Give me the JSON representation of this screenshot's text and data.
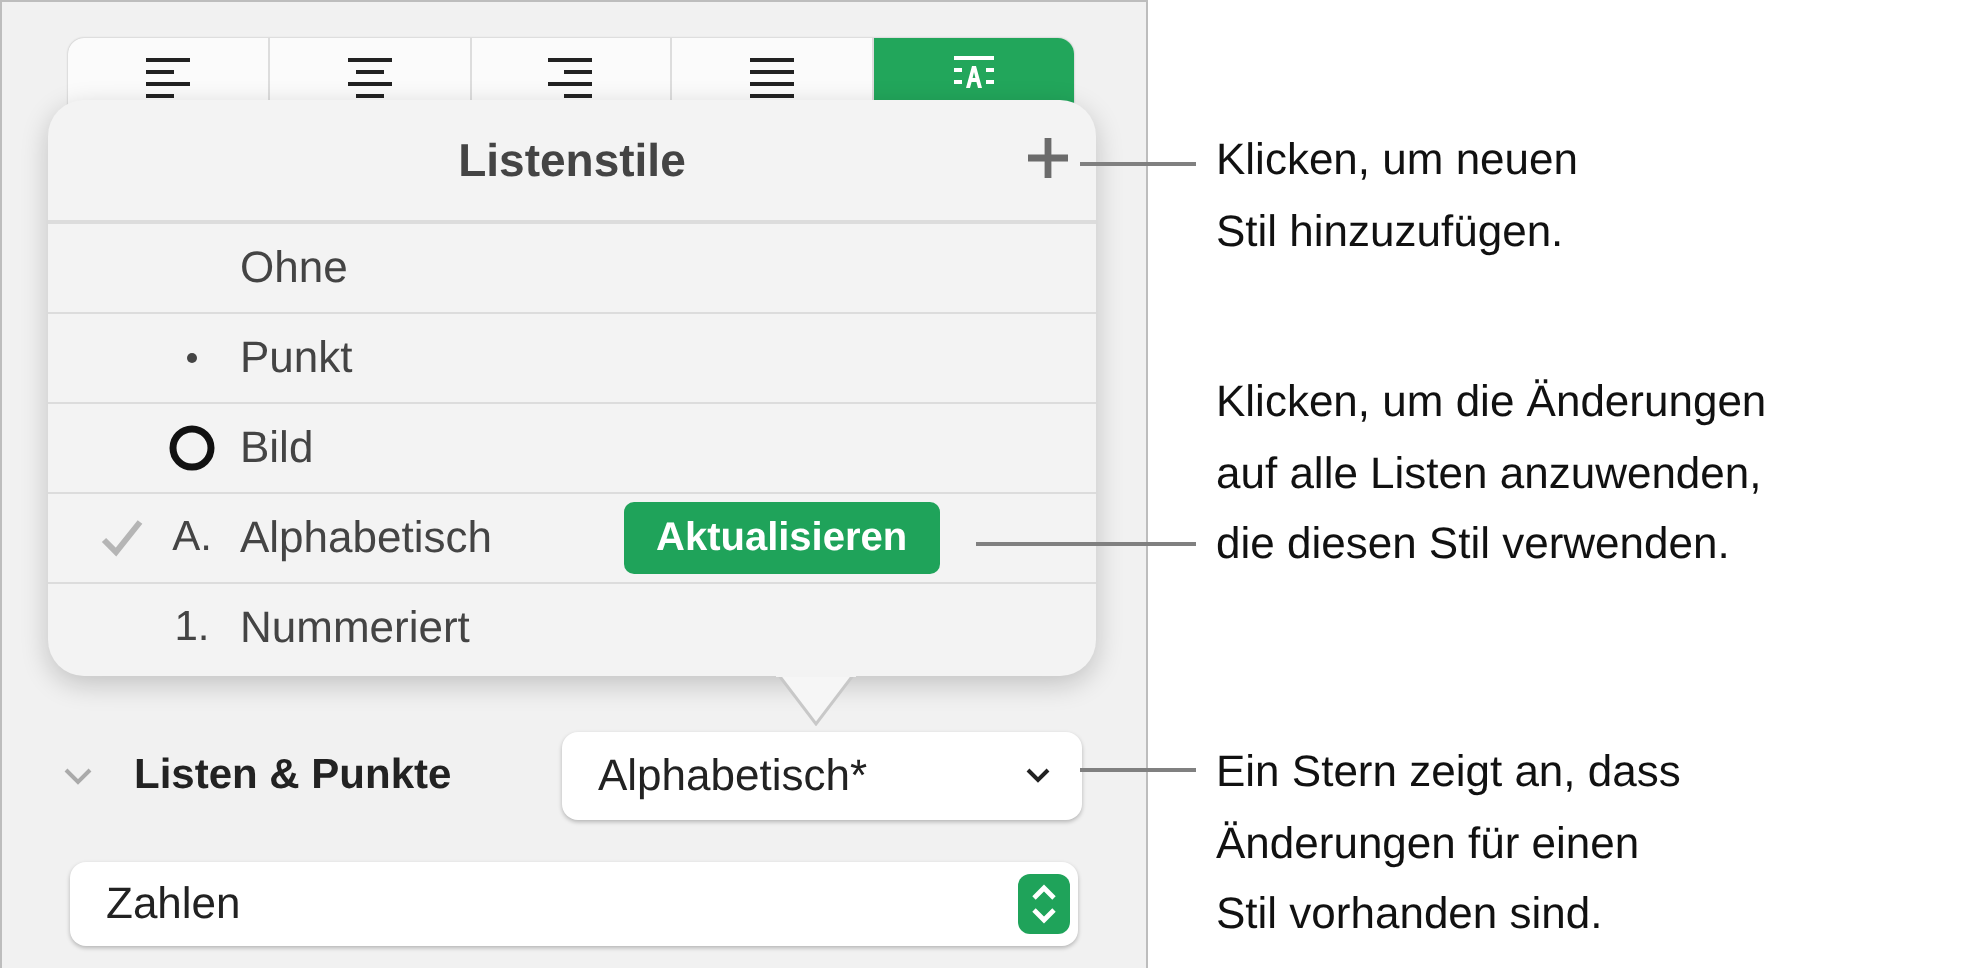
{
  "toolbar": {
    "buttons": [
      {
        "kind": "left",
        "selected": false
      },
      {
        "kind": "center",
        "selected": false
      },
      {
        "kind": "right",
        "selected": false
      },
      {
        "kind": "justify",
        "selected": false
      },
      {
        "kind": "textbox",
        "selected": true
      }
    ]
  },
  "popover": {
    "title": "Listenstile",
    "rows": [
      {
        "kind": "none",
        "label": "Ohne",
        "checked": false
      },
      {
        "kind": "bullet",
        "label": "Punkt",
        "checked": false
      },
      {
        "kind": "image",
        "label": "Bild",
        "checked": false
      },
      {
        "kind": "text",
        "marker": "A.",
        "label": "Alphabetisch",
        "checked": true,
        "action": "Aktualisieren"
      },
      {
        "kind": "text",
        "marker": "1.",
        "label": "Nummeriert",
        "checked": false
      }
    ]
  },
  "section": {
    "title": "Listen & Punkte",
    "expanded": true,
    "style_popup": "Alphabetisch*",
    "format_popup": "Zahlen"
  },
  "callouts": [
    {
      "lines": [
        "Klicken, um neuen",
        "Stil hinzuzufügen."
      ]
    },
    {
      "lines": [
        "Klicken, um die Änderungen",
        "auf alle Listen anzuwenden,",
        "die diesen Stil verwenden."
      ]
    },
    {
      "lines": [
        "Ein Stern zeigt an, dass",
        "Änderungen für einen",
        "Stil vorhanden sind."
      ]
    }
  ]
}
